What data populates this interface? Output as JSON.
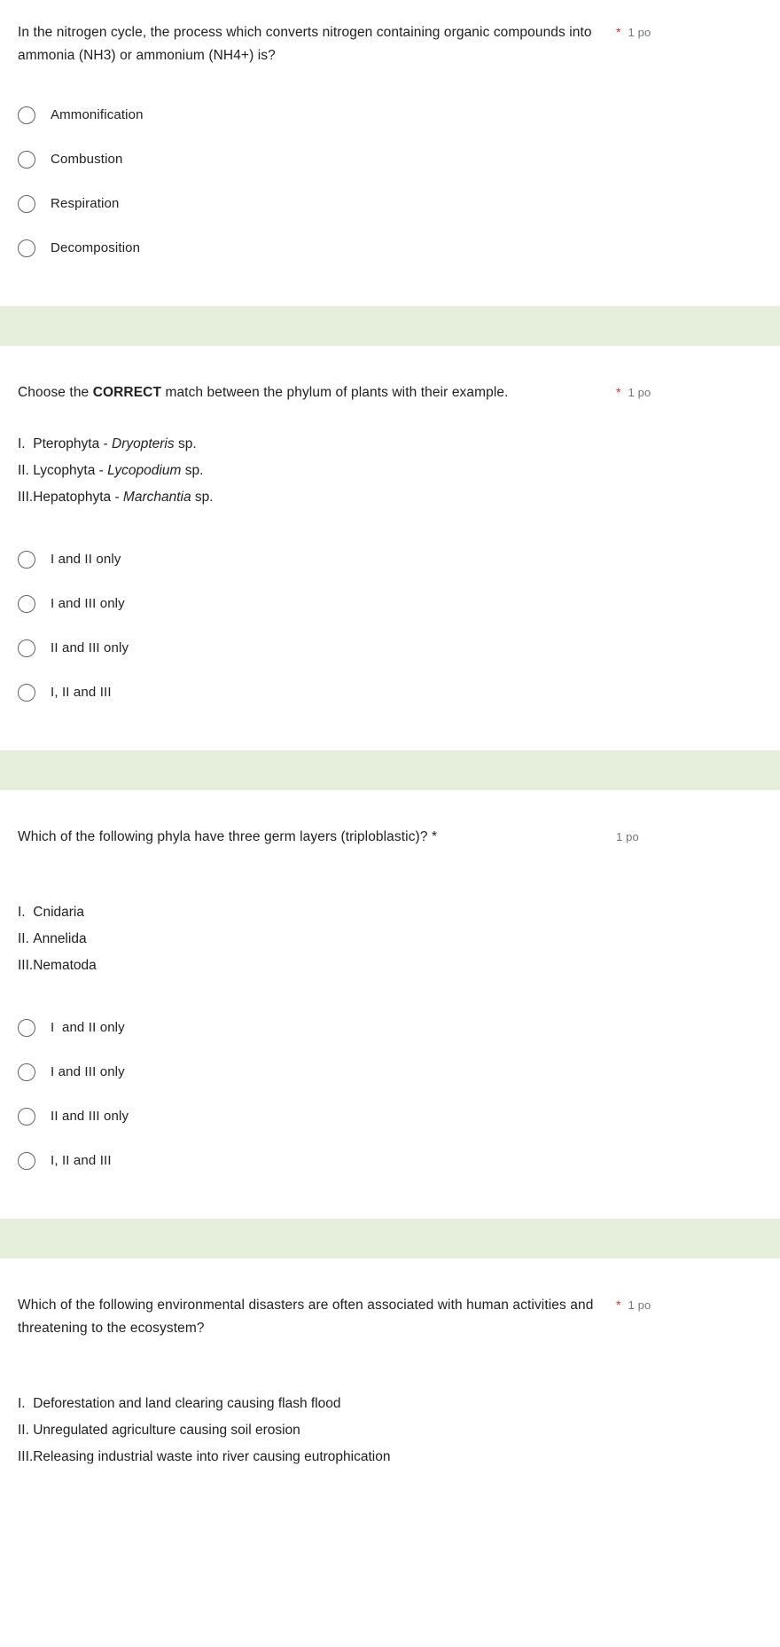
{
  "theme": {
    "section_divider_color": "#e6eedc",
    "required_asterisk_color": "#d93025",
    "text_color": "#202124",
    "points_text_color": "#70757a",
    "radio_border_color": "#5f6368",
    "page_background": "#ffffff"
  },
  "questions": [
    {
      "id": "q1",
      "title_plain": "In the nitrogen cycle, the process which converts nitrogen containing organic compounds into ammonia (NH3) or ammonium (NH4+) is?",
      "required_marker": "*",
      "points": "1 po",
      "options": [
        "Ammonification",
        "Combustion",
        "Respiration",
        "Decomposition"
      ]
    },
    {
      "id": "q2",
      "title_part1": "Choose the ",
      "title_bold": "CORRECT",
      "title_part2": " match between the phylum of plants with their example.",
      "required_marker": "*",
      "points": "1 po",
      "stem": [
        {
          "num": "I.",
          "text_before": "Pterophyta - ",
          "italic": "Dryopteris",
          "text_after": " sp."
        },
        {
          "num": "II.",
          "text_before": "Lycophyta - ",
          "italic": "Lycopodium",
          "text_after": " sp."
        },
        {
          "num": "III.",
          "text_before": "Hepatophyta - ",
          "italic": "Marchantia",
          "text_after": " sp."
        }
      ],
      "options": [
        "I and II only",
        "I and III only",
        "II and III only",
        "I, II and III"
      ]
    },
    {
      "id": "q3",
      "title_plain": "Which of the following phyla have three germ layers (triploblastic)? *",
      "points": "1 po",
      "stem": [
        {
          "num": "I.",
          "text_before": "Cnidaria",
          "italic": "",
          "text_after": ""
        },
        {
          "num": "II.",
          "text_before": "Annelida",
          "italic": "",
          "text_after": ""
        },
        {
          "num": "III.",
          "text_before": "Nematoda",
          "italic": "",
          "text_after": ""
        }
      ],
      "options": [
        "I  and II only",
        "I and III only",
        "II and III only",
        "I, II and III"
      ]
    },
    {
      "id": "q4",
      "title_plain": "Which of the following environmental disasters are often associated with human activities and threatening to the ecosystem?",
      "required_marker": "*",
      "points": "1 po",
      "stem": [
        {
          "num": "I.",
          "text_before": "Deforestation and land clearing causing flash flood",
          "italic": "",
          "text_after": ""
        },
        {
          "num": "II.",
          "text_before": "Unregulated agriculture causing soil erosion",
          "italic": "",
          "text_after": ""
        },
        {
          "num": "III.",
          "text_before": "Releasing industrial waste into river causing eutrophication",
          "italic": "",
          "text_after": ""
        }
      ],
      "options": []
    }
  ]
}
